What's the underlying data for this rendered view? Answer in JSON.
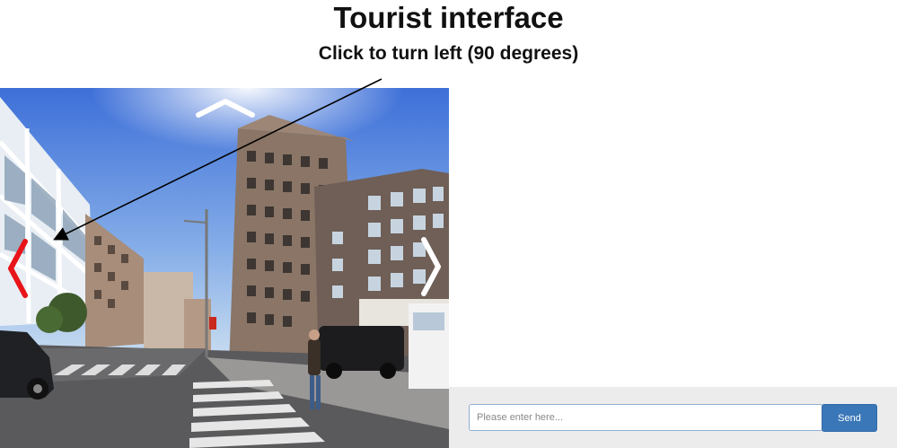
{
  "header": {
    "title": "Tourist interface",
    "subtitle": "Click to turn left (90 degrees)"
  },
  "street_view": {
    "left_arrow_color": "#e8141a",
    "arrow_color": "#ffffff"
  },
  "chat": {
    "placeholder": "Please enter here...",
    "send_label": "Send",
    "accent": "#3a77b8"
  }
}
